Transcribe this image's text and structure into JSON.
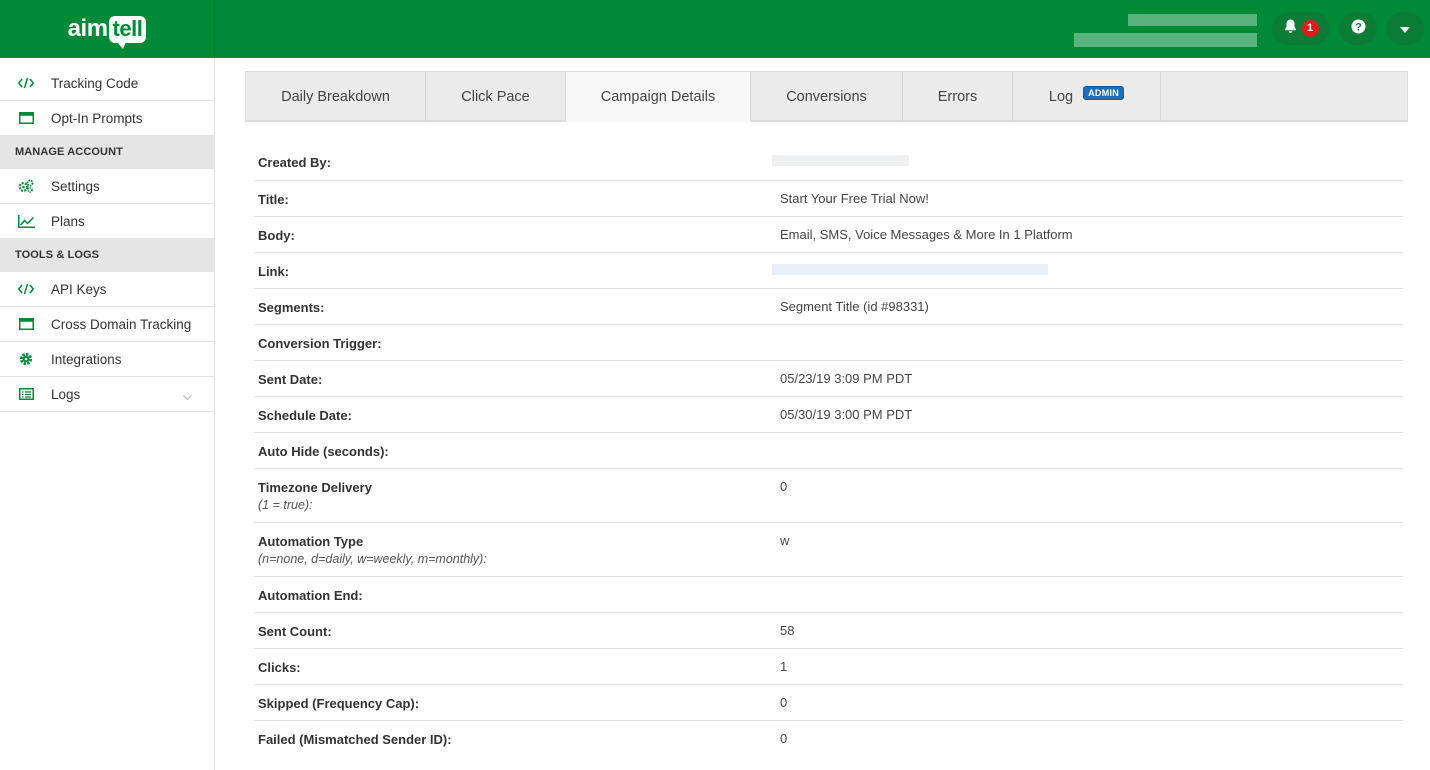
{
  "header": {
    "logo": {
      "part1": "aim",
      "part2": "tell"
    },
    "notification_count": "1",
    "icons": {
      "bell": "bell-icon",
      "help": "question-circle-icon",
      "caret": "chevron-down-icon"
    },
    "brand_color": "#008a37"
  },
  "sidebar": {
    "items_top": [
      {
        "label": "Tracking Code",
        "icon": "code-icon"
      },
      {
        "label": "Opt-In Prompts",
        "icon": "window-icon"
      }
    ],
    "section_manage": "MANAGE ACCOUNT",
    "items_manage": [
      {
        "label": "Settings",
        "icon": "gears-icon"
      },
      {
        "label": "Plans",
        "icon": "line-chart-icon"
      }
    ],
    "section_tools": "TOOLS & LOGS",
    "items_tools": [
      {
        "label": "API Keys",
        "icon": "code-icon"
      },
      {
        "label": "Cross Domain Tracking",
        "icon": "window-icon"
      },
      {
        "label": "Integrations",
        "icon": "gear-icon"
      },
      {
        "label": "Logs",
        "icon": "list-icon"
      }
    ]
  },
  "tabs": {
    "items": [
      "Daily Breakdown",
      "Click Pace",
      "Campaign Details",
      "Conversions",
      "Errors",
      "Log"
    ],
    "active": "Campaign Details",
    "log_badge": "ADMIN"
  },
  "details": [
    {
      "label": "Created By:",
      "value": ""
    },
    {
      "label": "Title:",
      "value": "Start Your Free Trial Now!"
    },
    {
      "label": "Body:",
      "value": "Email, SMS, Voice Messages & More In 1 Platform"
    },
    {
      "label": "Link:",
      "value": ""
    },
    {
      "label": "Segments:",
      "value": "Segment Title (id #98331)"
    },
    {
      "label": "Conversion Trigger:",
      "value": ""
    },
    {
      "label": "Sent Date:",
      "value": "05/23/19 3:09 PM PDT"
    },
    {
      "label": "Schedule Date:",
      "value": "05/30/19 3:00 PM PDT"
    },
    {
      "label": "Auto Hide (seconds):",
      "value": ""
    },
    {
      "label": "Timezone Delivery",
      "sub": "(1 = true):",
      "value": "0"
    },
    {
      "label": "Automation Type",
      "sub": "(n=none, d=daily, w=weekly, m=monthly):",
      "value": "w"
    },
    {
      "label": "Automation End:",
      "value": ""
    },
    {
      "label": "Sent Count:",
      "value": "58"
    },
    {
      "label": "Clicks:",
      "value": "1"
    },
    {
      "label": "Skipped (Frequency Cap):",
      "value": "0"
    },
    {
      "label": "Failed (Mismatched Sender ID):",
      "value": "0"
    }
  ]
}
